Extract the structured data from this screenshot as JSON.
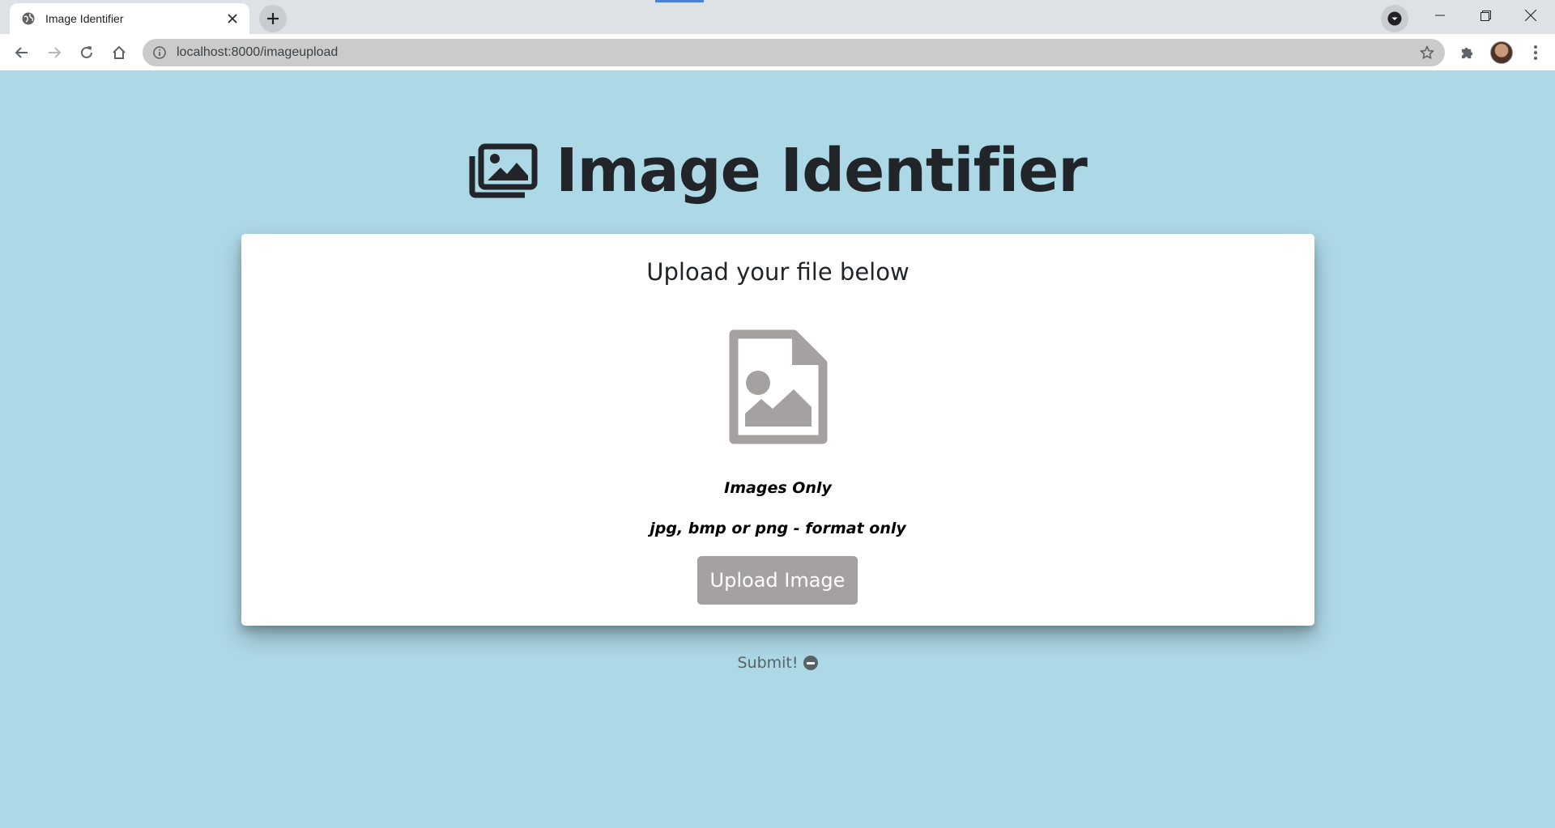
{
  "browser": {
    "tab_title": "Image Identifier",
    "new_tab_label": "+",
    "close_label": "✕",
    "url": "localhost:8000/imageupload"
  },
  "page": {
    "title": "Image Identifier",
    "card_heading": "Upload your file below",
    "note_primary": "Images Only",
    "note_secondary": "jpg, bmp or png - format only",
    "upload_button": "Upload Image",
    "submit_label": "Submit!"
  },
  "colors": {
    "page_background": "#add8e6",
    "card_background": "#ffffff",
    "button_background": "#a6a1a1",
    "icon_gray": "#a6a1a1",
    "title_text": "#212529",
    "submit_text": "#5a6268"
  },
  "icons": {
    "title": "images-icon",
    "card": "file-image-icon",
    "submit": "minus-circle-icon"
  }
}
